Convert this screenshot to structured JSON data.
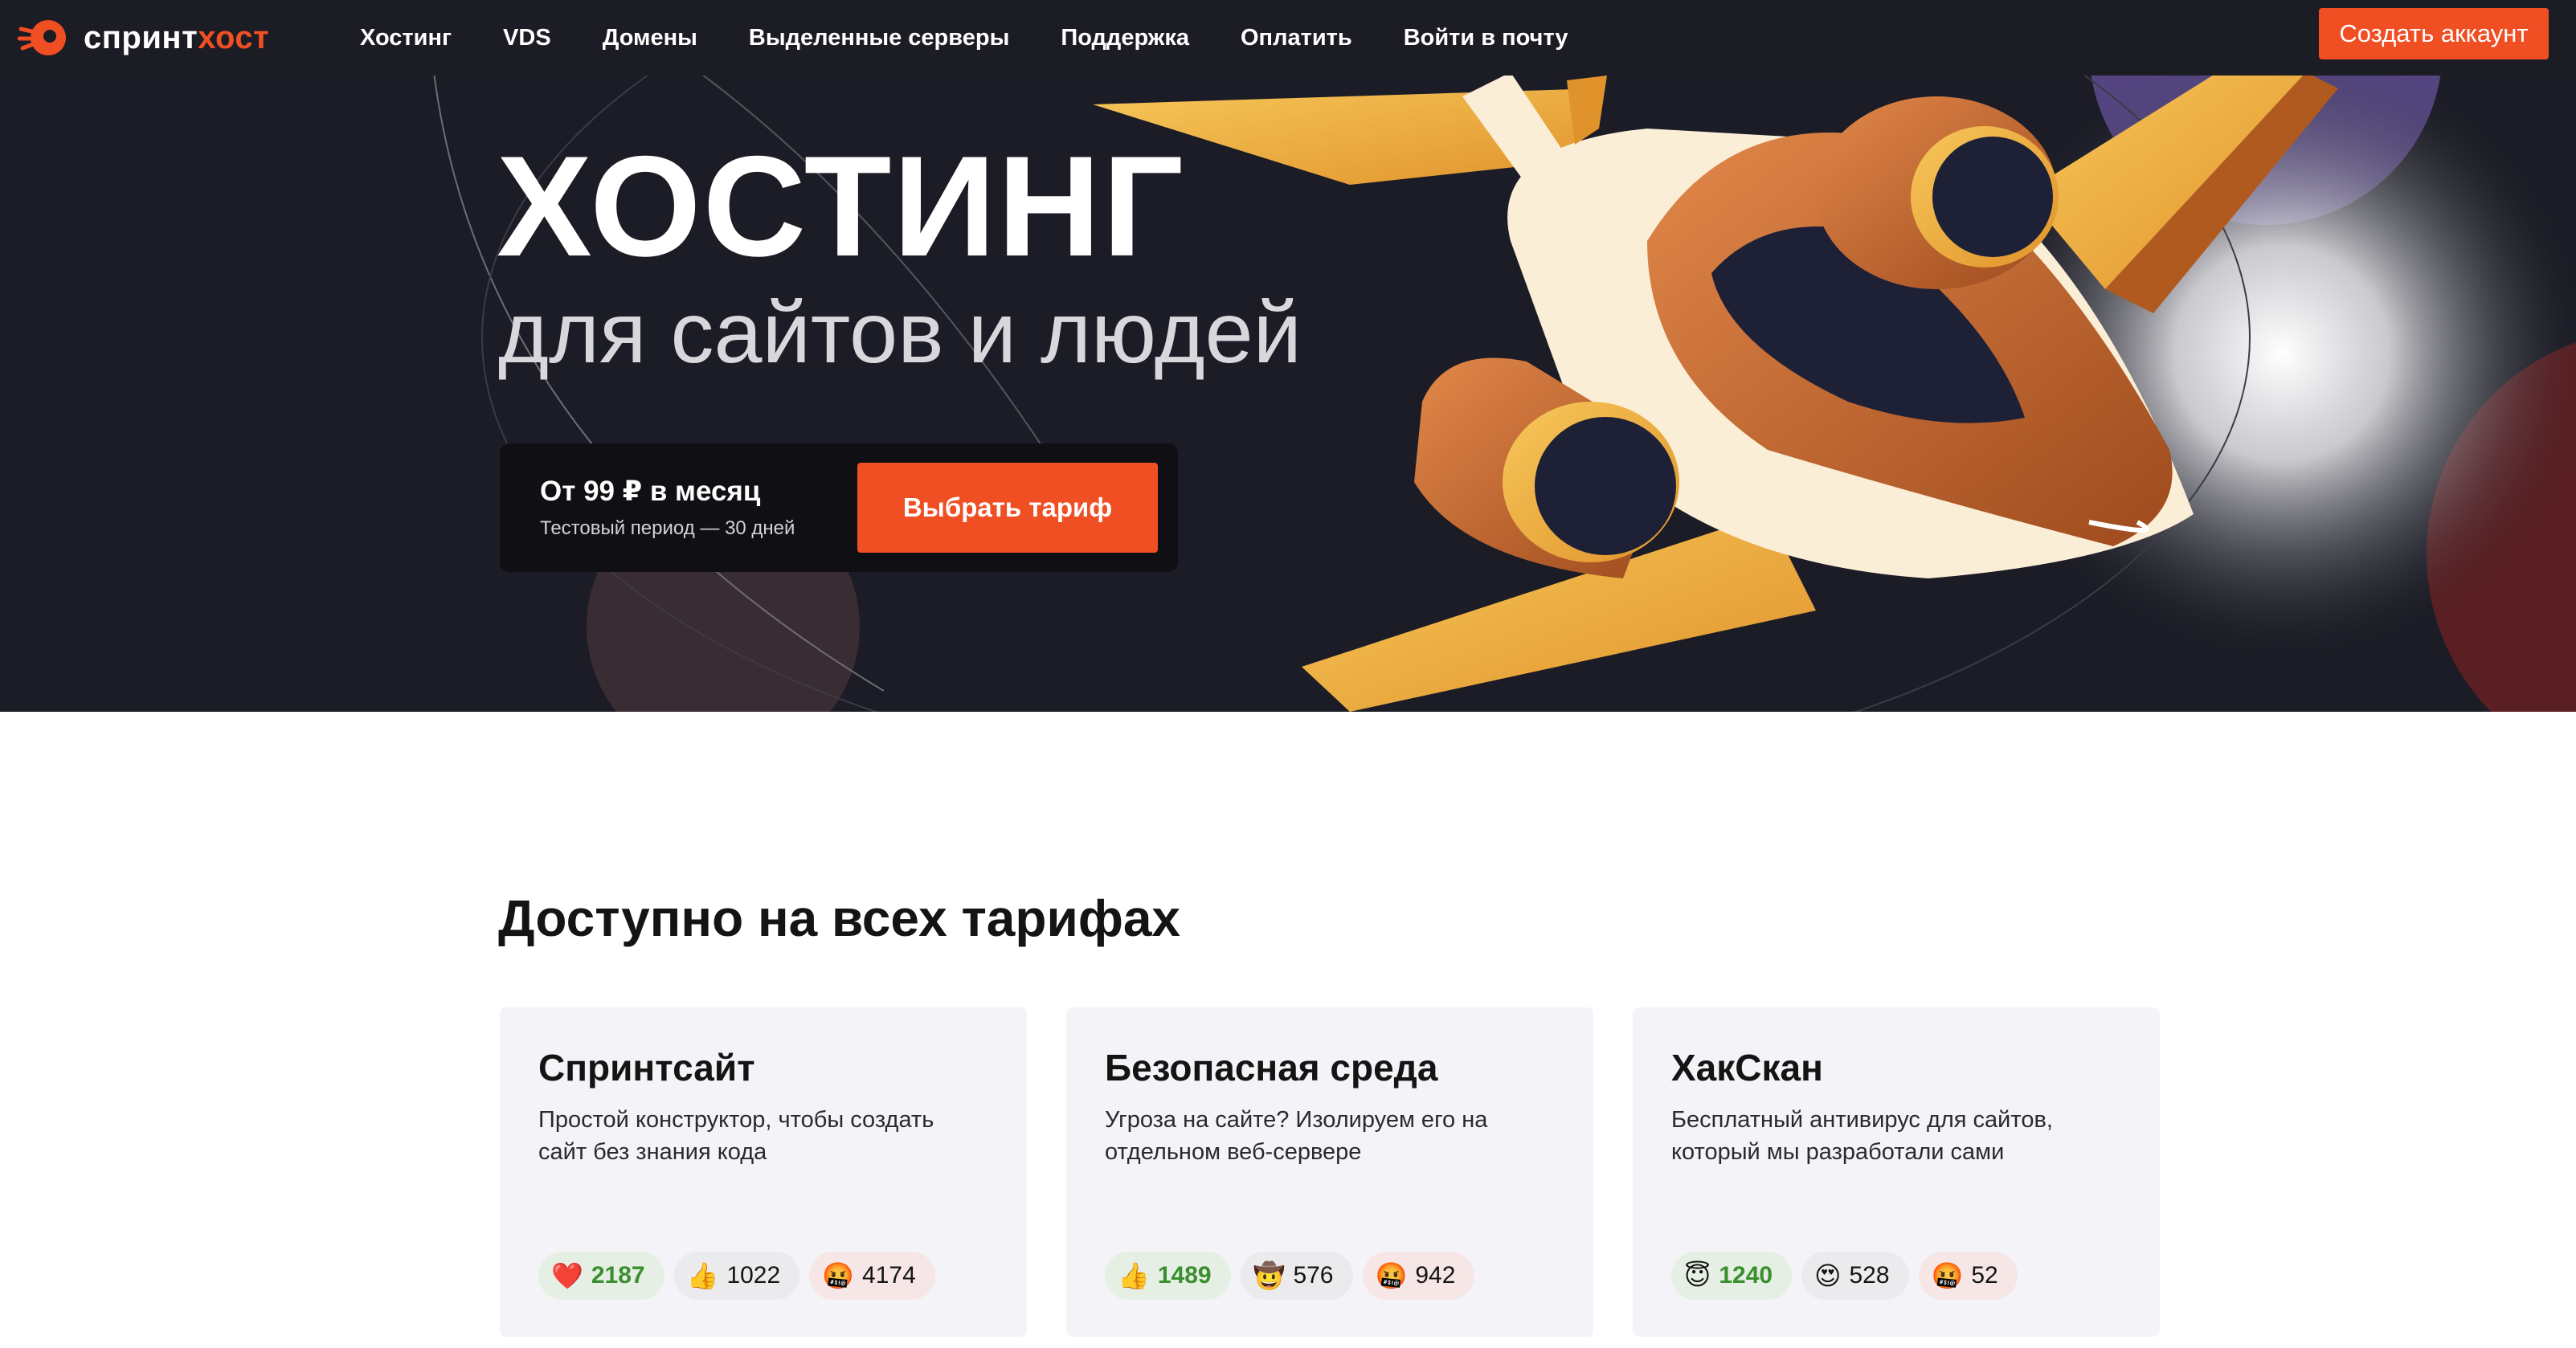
{
  "header": {
    "logo_primary": "спринт",
    "logo_accent": "хост",
    "nav": [
      "Хостинг",
      "VDS",
      "Домены",
      "Выделенные серверы",
      "Поддержка",
      "Оплатить",
      "Войти в почту"
    ],
    "cta": "Создать аккаунт"
  },
  "hero": {
    "title": "ХОСТИНГ",
    "subtitle": "для сайтов и людей",
    "price": "От 99 ₽ в месяц",
    "trial": "Тестовый период — 30 дней",
    "button": "Выбрать тариф"
  },
  "features": {
    "title": "Доступно на всех тарифах",
    "cards": [
      {
        "title": "Спринтсайт",
        "description": "Простой конструктор, чтобы создать сайт без знания кода",
        "reactions": [
          {
            "emoji": "❤️",
            "count": "2187"
          },
          {
            "emoji": "👍",
            "count": "1022"
          },
          {
            "emoji": "🤬",
            "count": "4174"
          }
        ]
      },
      {
        "title": "Безопасная среда",
        "description": "Угроза на сайте? Изолируем его на отдельном веб-сервере",
        "reactions": [
          {
            "emoji": "👍",
            "count": "1489"
          },
          {
            "emoji": "🤠",
            "count": "576"
          },
          {
            "emoji": "🤬",
            "count": "942"
          }
        ]
      },
      {
        "title": "ХакСкан",
        "description": "Бесплатный антивирус для сайтов, который мы разработали сами",
        "reactions": [
          {
            "emoji": "😇",
            "count": "1240"
          },
          {
            "emoji": "😍",
            "count": "528"
          },
          {
            "emoji": "🤬",
            "count": "52"
          }
        ]
      }
    ]
  },
  "colors": {
    "accent": "#f04e23",
    "hero_bg": "#1c1c26",
    "positive": "#3a8f2e"
  }
}
